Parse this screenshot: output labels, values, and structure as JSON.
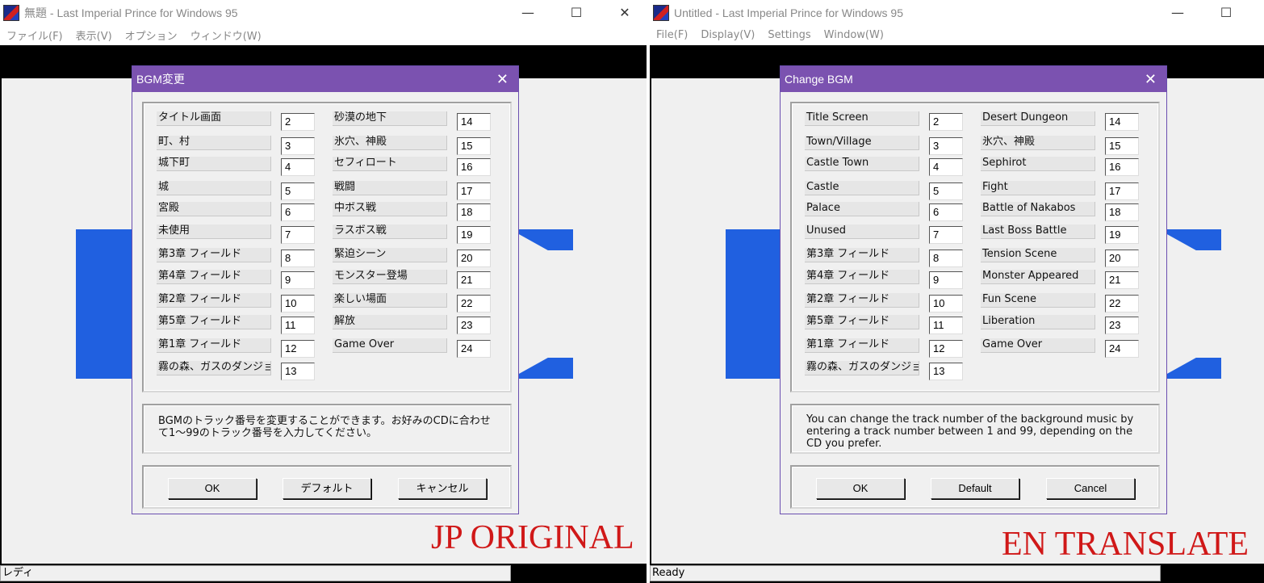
{
  "colors": {
    "title_bar_dialog": "#7b52b0",
    "overlay_label": "#d01818",
    "logo_blue": "#2060e0"
  },
  "jp": {
    "window_title": "無題 - Last Imperial Prince for Windows 95",
    "menu": [
      "ファイル(F)",
      "表示(V)",
      "オプション",
      "ウィンドウ(W)"
    ],
    "dialog_title": "BGM変更",
    "left_rows": [
      {
        "label": "タイトル画面",
        "value": "2"
      },
      {
        "label": "町、村",
        "value": "3"
      },
      {
        "label": "城下町",
        "value": "4"
      },
      {
        "label": "城",
        "value": "5"
      },
      {
        "label": "宮殿",
        "value": "6"
      },
      {
        "label": "未使用",
        "value": "7"
      },
      {
        "label": "第3章 フィールド",
        "value": "8"
      },
      {
        "label": "第4章 フィールド",
        "value": "9"
      },
      {
        "label": "第2章 フィールド",
        "value": "10"
      },
      {
        "label": "第5章 フィールド",
        "value": "11"
      },
      {
        "label": "第1章 フィールド",
        "value": "12"
      },
      {
        "label": "霧の森、ガスのダンジョン",
        "value": "13"
      }
    ],
    "right_rows": [
      {
        "label": "砂漠の地下",
        "value": "14"
      },
      {
        "label": "氷穴、神殿",
        "value": "15"
      },
      {
        "label": "セフィロート",
        "value": "16"
      },
      {
        "label": "戦闘",
        "value": "17"
      },
      {
        "label": "中ボス戦",
        "value": "18"
      },
      {
        "label": "ラスボス戦",
        "value": "19"
      },
      {
        "label": "緊迫シーン",
        "value": "20"
      },
      {
        "label": "モンスター登場",
        "value": "21"
      },
      {
        "label": "楽しい場面",
        "value": "22"
      },
      {
        "label": "解放",
        "value": "23"
      },
      {
        "label": "Game Over",
        "value": "24"
      }
    ],
    "description": "BGMのトラック番号を変更することができます。お好みのCDに合わせて1～99のトラック番号を入力してください。",
    "buttons": {
      "ok": "OK",
      "default": "デフォルト",
      "cancel": "キャンセル"
    },
    "status": "レディ",
    "overlay_label": "JP ORIGINAL"
  },
  "en": {
    "window_title": "Untitled - Last Imperial Prince for Windows 95",
    "menu": [
      "File(F)",
      "Display(V)",
      "Settings",
      "Window(W)"
    ],
    "dialog_title": "Change BGM",
    "left_rows": [
      {
        "label": "Title Screen",
        "value": "2"
      },
      {
        "label": "Town/Village",
        "value": "3"
      },
      {
        "label": "Castle Town",
        "value": "4"
      },
      {
        "label": "Castle",
        "value": "5"
      },
      {
        "label": "Palace",
        "value": "6"
      },
      {
        "label": "Unused",
        "value": "7"
      },
      {
        "label": "第3章 フィールド",
        "value": "8"
      },
      {
        "label": "第4章 フィールド",
        "value": "9"
      },
      {
        "label": "第2章 フィールド",
        "value": "10"
      },
      {
        "label": "第5章 フィールド",
        "value": "11"
      },
      {
        "label": "第1章 フィールド",
        "value": "12"
      },
      {
        "label": "霧の森、ガスのダンジョン",
        "value": "13"
      }
    ],
    "right_rows": [
      {
        "label": "Desert Dungeon",
        "value": "14"
      },
      {
        "label": "氷穴、神殿",
        "value": "15"
      },
      {
        "label": "Sephirot",
        "value": "16"
      },
      {
        "label": "Fight",
        "value": "17"
      },
      {
        "label": "Battle of Nakabos",
        "value": "18"
      },
      {
        "label": "Last Boss Battle",
        "value": "19"
      },
      {
        "label": "Tension Scene",
        "value": "20"
      },
      {
        "label": "Monster Appeared",
        "value": "21"
      },
      {
        "label": "Fun Scene",
        "value": "22"
      },
      {
        "label": "Liberation",
        "value": "23"
      },
      {
        "label": "Game Over",
        "value": "24"
      }
    ],
    "description": "You can change the track number of the background music by entering a track number between 1 and 99, depending on the CD you prefer.",
    "buttons": {
      "ok": "OK",
      "default": "Default",
      "cancel": "Cancel"
    },
    "status": "Ready",
    "overlay_label": "EN TRANSLATE"
  }
}
